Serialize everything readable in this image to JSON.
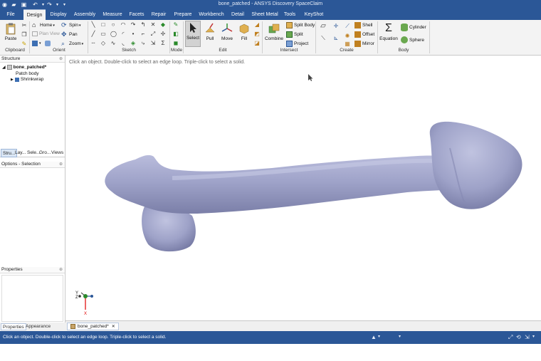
{
  "window": {
    "title": "bone_patched - ANSYS Discovery SpaceClaim"
  },
  "quick_access": [
    "app-icon",
    "open-icon",
    "save-icon",
    "undo-icon",
    "redo-icon"
  ],
  "tabs": [
    {
      "label": "File",
      "active": false
    },
    {
      "label": "Design",
      "active": true
    },
    {
      "label": "Display",
      "active": false
    },
    {
      "label": "Assembly",
      "active": false
    },
    {
      "label": "Measure",
      "active": false
    },
    {
      "label": "Facets",
      "active": false
    },
    {
      "label": "Repair",
      "active": false
    },
    {
      "label": "Prepare",
      "active": false
    },
    {
      "label": "Workbench",
      "active": false
    },
    {
      "label": "Detail",
      "active": false
    },
    {
      "label": "Sheet Metal",
      "active": false
    },
    {
      "label": "Tools",
      "active": false
    },
    {
      "label": "KeyShot",
      "active": false
    }
  ],
  "ribbon": {
    "clipboard": {
      "label": "Clipboard",
      "paste": "Paste"
    },
    "orient": {
      "label": "Orient",
      "home": "Home",
      "plan_view": "Plan View",
      "zoom": "Zoom",
      "spin": "Spin",
      "pan": "Pan"
    },
    "sketch": {
      "label": "Sketch"
    },
    "mode": {
      "label": "Mode"
    },
    "edit": {
      "label": "Edit",
      "select": "Select",
      "pull": "Pull",
      "move": "Move",
      "fill": "Fill"
    },
    "intersect": {
      "label": "Intersect",
      "combine": "Combine",
      "split_body": "Split Body",
      "split": "Split",
      "project": "Project"
    },
    "create": {
      "label": "Create",
      "shell": "Shell",
      "offset": "Offset",
      "mirror": "Mirror"
    },
    "body": {
      "label": "Body",
      "equation": "Equation",
      "cylinder": "Cylinder",
      "sphere": "Sphere"
    }
  },
  "structure": {
    "header": "Structure",
    "root": "bone_patched*",
    "children": [
      "Patch body",
      "Shrinkwrap"
    ]
  },
  "panel_tabs": [
    "Stru...",
    "Lay...",
    "Sele...",
    "Gro...",
    "Views"
  ],
  "options": {
    "header": "Options - Selection"
  },
  "properties": {
    "header": "Properties"
  },
  "bottom_tabs": [
    "Properties",
    "Appearance"
  ],
  "viewport": {
    "hint": "Click an object. Double-click to select an edge loop. Triple-click to select a solid.",
    "model_color": "#9fa3c9",
    "triad": {
      "y": "Y",
      "z": "Z",
      "x": "X"
    }
  },
  "document_tab": {
    "label": "bone_patched*"
  },
  "status": {
    "text": "Click an object. Double-click to select an edge loop. Triple-click to select a solid."
  },
  "colors": {
    "accent": "#2b5797",
    "ribbon_bg": "#f3f3f3"
  }
}
